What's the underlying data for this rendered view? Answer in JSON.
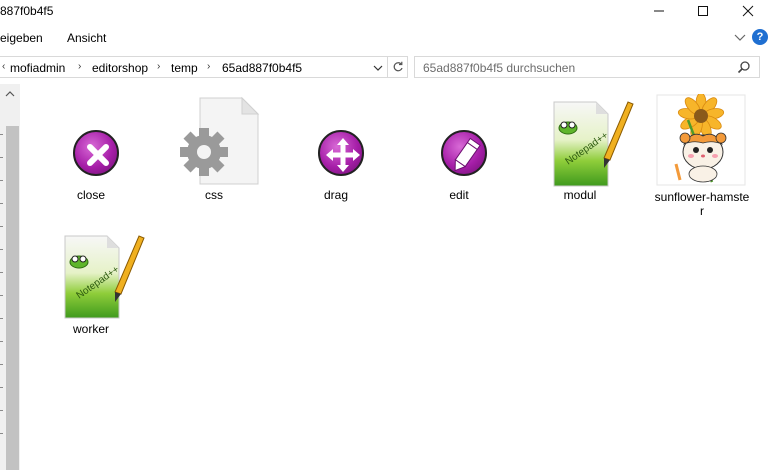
{
  "window": {
    "title": "887f0b4f5"
  },
  "ribbon": {
    "tabs": [
      {
        "label": "eigeben"
      },
      {
        "label": "Ansicht"
      }
    ]
  },
  "address": {
    "crumbs": [
      "mofiadmin",
      "editorshop",
      "temp",
      "65ad887f0b4f5"
    ]
  },
  "search": {
    "placeholder": "65ad887f0b4f5 durchsuchen"
  },
  "files": [
    {
      "label": "close",
      "kind": "close-icon"
    },
    {
      "label": "css",
      "kind": "gear-file-icon"
    },
    {
      "label": "drag",
      "kind": "move-icon"
    },
    {
      "label": "edit",
      "kind": "pencil-icon"
    },
    {
      "label": "modul",
      "kind": "notepadpp-icon"
    },
    {
      "label": "sunflower-hamster",
      "kind": "hamster-image-icon"
    },
    {
      "label": "worker",
      "kind": "notepadpp-icon"
    }
  ],
  "colors": {
    "accent": "#a61ea8",
    "help": "#1f6fd1",
    "scrollbar": "#c2c2c2"
  }
}
